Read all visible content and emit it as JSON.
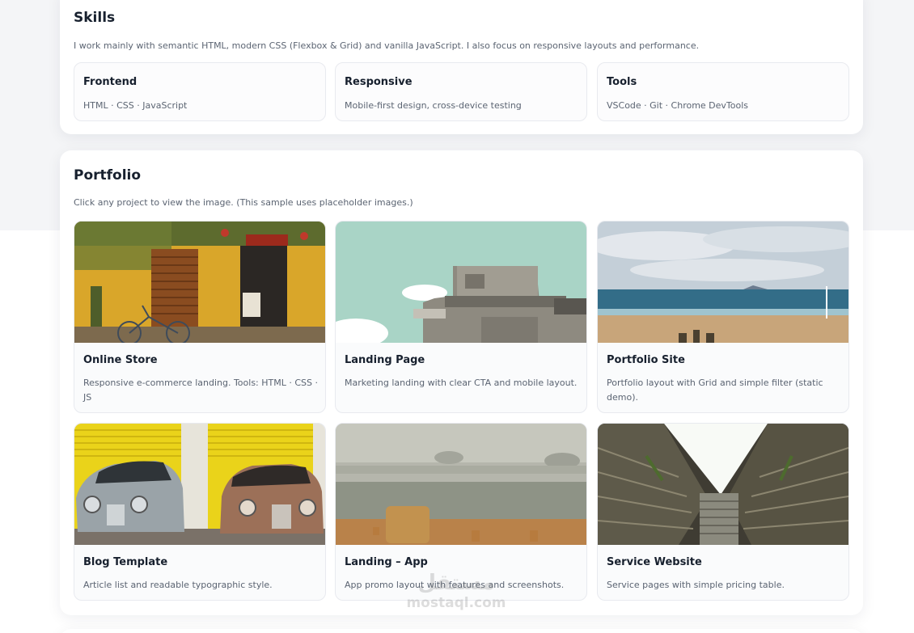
{
  "skills": {
    "title": "Skills",
    "description": "I work mainly with semantic HTML, modern CSS (Flexbox & Grid) and vanilla JavaScript. I also focus on responsive layouts and performance.",
    "items": [
      {
        "title": "Frontend",
        "detail": "HTML · CSS · JavaScript"
      },
      {
        "title": "Responsive",
        "detail": "Mobile-first design, cross-device testing"
      },
      {
        "title": "Tools",
        "detail": "VSCode · Git · Chrome DevTools"
      }
    ]
  },
  "portfolio": {
    "title": "Portfolio",
    "description": "Click any project to view the image. (This sample uses placeholder images.)",
    "projects": [
      {
        "title": "Online Store",
        "description": "Responsive e-commerce landing. Tools: HTML · CSS · JS",
        "image": "yellow-storefront-bicycle"
      },
      {
        "title": "Landing Page",
        "description": "Marketing landing with clear CTA and mobile layout.",
        "image": "concrete-bunker-sky"
      },
      {
        "title": "Portfolio Site",
        "description": "Portfolio layout with Grid and simple filter (static demo).",
        "image": "beach-sea-horizon"
      },
      {
        "title": "Blog Template",
        "description": "Article list and readable typographic style.",
        "image": "vintage-cars-yellow-shutters"
      },
      {
        "title": "Landing – App",
        "description": "App promo layout with features and screenshots.",
        "image": "misty-field-hay-bale"
      },
      {
        "title": "Service Website",
        "description": "Service pages with simple pricing table.",
        "image": "building-courtyard-looking-up"
      }
    ]
  },
  "watermark": {
    "arabic": "مستقل",
    "latin": "mostaql.com"
  },
  "colors": {
    "heading": "#17202e",
    "muted": "#5b6472",
    "card_border": "#e8eaef",
    "page_bg": "#f4f5f7"
  }
}
